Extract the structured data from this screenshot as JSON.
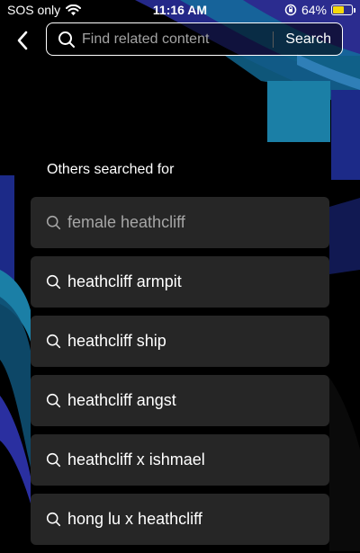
{
  "status_bar": {
    "carrier": "SOS only",
    "time": "11:16 AM",
    "battery_percent": "64%",
    "battery_level": 0.64,
    "icons": [
      "wifi-icon",
      "orientation-lock-icon",
      "battery-icon"
    ]
  },
  "header": {
    "back_icon": "chevron-left-icon",
    "search": {
      "placeholder": "Find related content",
      "value": "",
      "button_label": "Search"
    }
  },
  "related": {
    "title": "Others searched for",
    "items": [
      {
        "label": "female heathcliff",
        "icon": "search-icon"
      },
      {
        "label": "heathcliff armpit",
        "icon": "search-icon"
      },
      {
        "label": "heathcliff ship",
        "icon": "search-icon"
      },
      {
        "label": "heathcliff angst",
        "icon": "search-icon"
      },
      {
        "label": "heathcliff x ishmael",
        "icon": "search-icon"
      },
      {
        "label": "hong lu x heathcliff",
        "icon": "search-icon"
      }
    ]
  },
  "colors": {
    "background": "#000000",
    "card": "#262626",
    "accent_teal": "#1b7fa6",
    "accent_purple": "#3a3a9c",
    "battery": "#f5d90a"
  }
}
